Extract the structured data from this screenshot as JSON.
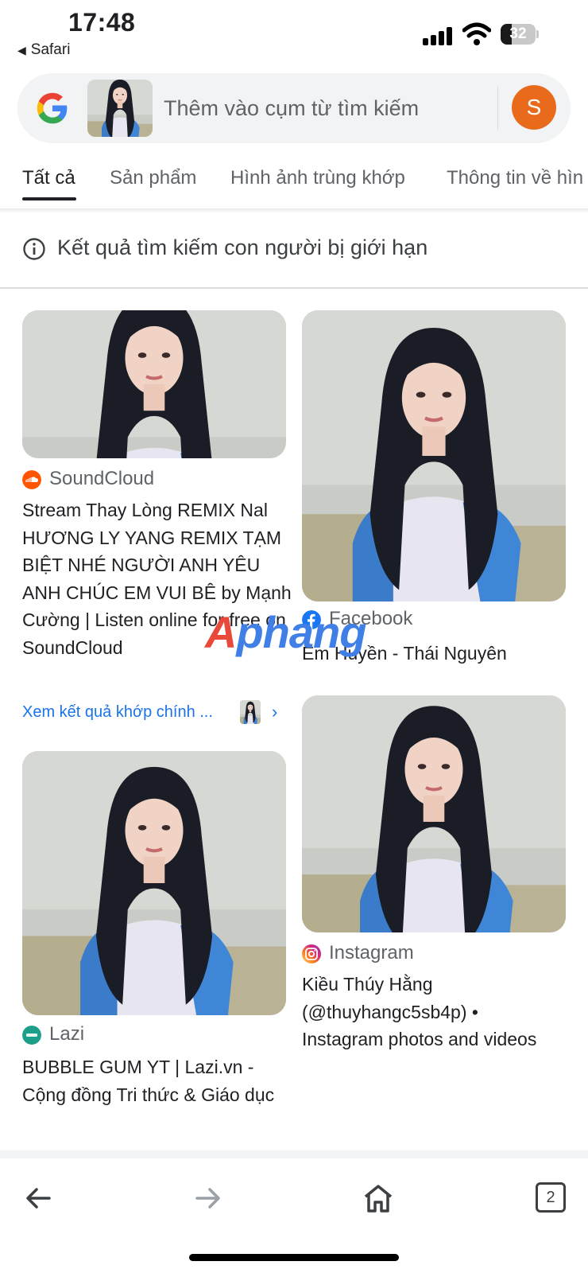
{
  "status_bar": {
    "time": "17:48",
    "back_app": "Safari",
    "battery_level": "32",
    "battery_fraction": 0.32
  },
  "search": {
    "placeholder": "Thêm vào cụm từ tìm kiếm",
    "avatar_letter": "S"
  },
  "tabs": [
    {
      "label": "Tất cả",
      "active": true
    },
    {
      "label": "Sản phẩm",
      "active": false
    },
    {
      "label": "Hình ảnh trùng khớp",
      "active": false
    },
    {
      "label": "Thông tin về hìn",
      "active": false
    }
  ],
  "notice": {
    "text": "Kết quả tìm kiếm con người bị giới hạn",
    "icon": "info-icon"
  },
  "results": [
    {
      "source": "SoundCloud",
      "source_icon": "soundcloud-icon",
      "title": "Stream Thay Lòng REMIX Nal HƯƠNG LY YANG REMIX TẠM BIỆT NHÉ NGƯỜI ANH YÊU ANH CHÚC EM VUI BÊ by Mạnh Cường | Listen online for free on SoundCloud",
      "match_link": "Xem kết quả khớp chính ..."
    },
    {
      "source": "Facebook",
      "source_icon": "facebook-icon",
      "title": "Em Huyền - Thái Nguyên"
    },
    {
      "source": "Lazi",
      "source_icon": "lazi-icon",
      "title": "BUBBLE GUM YT | Lazi.vn - Cộng đồng Tri thức & Giáo dục"
    },
    {
      "source": "Instagram",
      "source_icon": "instagram-icon",
      "title": "Kiều Thúy Hằng (@thuyhangc5sb4p) • Instagram photos and videos"
    }
  ],
  "watermark": {
    "part1": "A",
    "part2": "phang"
  },
  "toolbar": {
    "tab_count": "2",
    "icons": [
      "back-arrow-icon",
      "forward-arrow-icon",
      "home-icon",
      "tabs-icon"
    ]
  },
  "colors": {
    "link_blue": "#1a73e8",
    "avatar_orange": "#ea6a1c",
    "soundcloud": "#ff5500",
    "facebook": "#1877f2",
    "lazi": "#1b9e8a"
  }
}
